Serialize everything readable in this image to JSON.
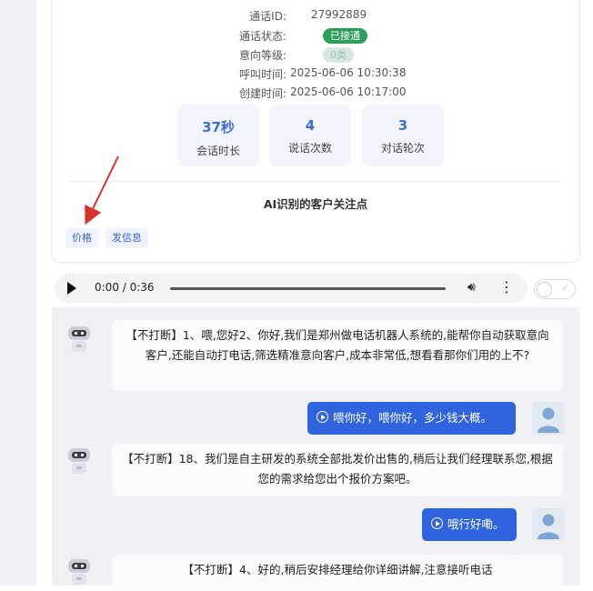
{
  "call_info": {
    "call_id_label": "通话ID:",
    "call_id": "27992889",
    "status_label": "通话状态:",
    "status": "已接通",
    "intent_label": "意向等级:",
    "intent": "0类",
    "call_time_label": "呼叫时间:",
    "call_time": "2025-06-06 10:30:38",
    "create_time_label": "创建时间:",
    "create_time": "2025-06-06 10:17:00"
  },
  "stats": [
    {
      "value": "37秒",
      "label": "会话时长"
    },
    {
      "value": "4",
      "label": "说话次数"
    },
    {
      "value": "3",
      "label": "对话轮次"
    }
  ],
  "focus": {
    "title": "AI识别的客户关注点",
    "tags": [
      "价格",
      "发信息"
    ]
  },
  "player": {
    "time": "0:00 / 0:36",
    "progress": 0
  },
  "messages": [
    {
      "side": "bot",
      "text": "【不打断】1、喂,您好2、你好,我们是郑州做电话机器人系统的,能帮你自动获取意向客户,还能自动打电话,筛选精准意向客户,成本非常低,想看看那你们用的上不?"
    },
    {
      "side": "user",
      "text": "喂你好，喂你好，多少钱大概。"
    },
    {
      "side": "bot",
      "text": "【不打断】18、我们是自主研发的系统全部批发价出售的,稍后让我们经理联系您,根据您的需求给您出个报价方案吧。"
    },
    {
      "side": "user",
      "text": "哦行好嘞。"
    },
    {
      "side": "bot",
      "text": "【不打断】4、好的,稍后安排经理给你详细讲解,注意接听电话"
    }
  ],
  "colors": {
    "accent": "#2f63e0",
    "status_green": "#2e9e5b",
    "stat_value": "#3b6fd6",
    "annotation_arrow": "#d9322b"
  }
}
